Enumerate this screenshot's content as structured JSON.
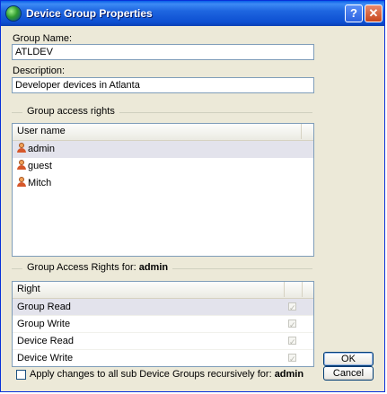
{
  "window": {
    "title": "Device Group Properties",
    "help_label": "?",
    "close_label": "✕"
  },
  "form": {
    "group_name_label": "Group Name:",
    "group_name_value": "ATLDEV",
    "description_label": "Description:",
    "description_value": "Developer devices in Atlanta"
  },
  "access": {
    "section_label": "Group access rights",
    "column_user": "User name",
    "users": [
      "admin",
      "guest",
      "Mitch"
    ]
  },
  "rights": {
    "section_label_prefix": "Group Access Rights for: ",
    "selected_user": "admin",
    "column_right": "Right",
    "items": [
      {
        "label": "Group Read",
        "checked": true
      },
      {
        "label": "Group Write",
        "checked": true
      },
      {
        "label": "Device Read",
        "checked": true
      },
      {
        "label": "Device Write",
        "checked": true
      }
    ]
  },
  "footer": {
    "apply_label": "Apply changes to all sub Device Groups recursively for: ",
    "apply_user": "admin",
    "ok": "OK",
    "cancel": "Cancel"
  }
}
